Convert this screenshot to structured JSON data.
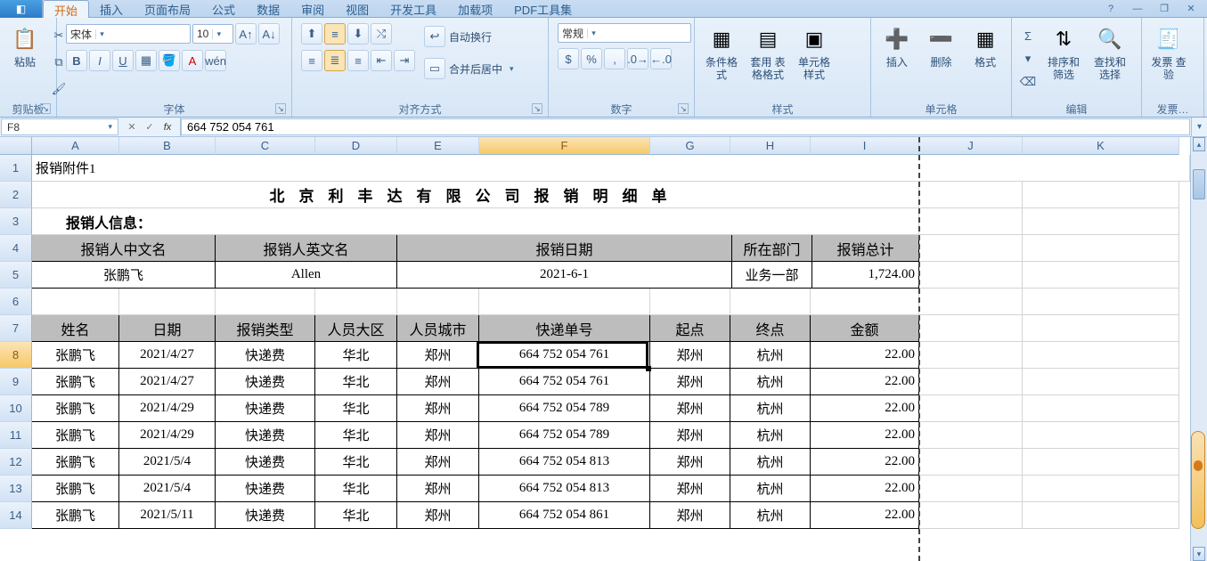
{
  "tabs": [
    "开始",
    "插入",
    "页面布局",
    "公式",
    "数据",
    "审阅",
    "视图",
    "开发工具",
    "加载项",
    "PDF工具集"
  ],
  "active_tab_index": 0,
  "help_icon": "?",
  "win_min": "—",
  "win_restore": "❐",
  "win_close": "✕",
  "clipboard": {
    "paste": "粘贴",
    "label": "剪贴板"
  },
  "font": {
    "name": "宋体",
    "size": "10",
    "label": "字体",
    "bold": "B",
    "italic": "I",
    "underline": "U"
  },
  "alignment": {
    "wrap_text": "自动换行",
    "merge": "合并后居中",
    "label": "对齐方式"
  },
  "number": {
    "format": "常规",
    "label": "数字"
  },
  "styles": {
    "cond": "条件格式",
    "table": "套用\n表格格式",
    "cell": "单元格\n样式",
    "label": "样式"
  },
  "cells": {
    "insert": "插入",
    "delete": "删除",
    "format": "格式",
    "label": "单元格"
  },
  "editing": {
    "sort": "排序和\n筛选",
    "find": "查找和\n选择",
    "label": "编辑"
  },
  "invoice": {
    "big": "发票\n查验",
    "label": "发票…"
  },
  "namebox": "F8",
  "formula": "664 752 054 761",
  "fx": "fx",
  "columns": [
    "A",
    "B",
    "C",
    "D",
    "E",
    "F",
    "G",
    "H",
    "I",
    "J",
    "K"
  ],
  "rows": [
    "1",
    "2",
    "3",
    "4",
    "5",
    "6",
    "7",
    "8",
    "9",
    "10",
    "11",
    "12",
    "13",
    "14"
  ],
  "active": {
    "col_index": 5,
    "row_index": 7
  },
  "content": {
    "r1a": "报销附件1",
    "r2_title": "北京利丰达有限公司报销明细单",
    "r3_label": "报销人信息：",
    "r4": {
      "cn": "报销人中文名",
      "en": "报销人英文名",
      "date": "报销日期",
      "dept": "所在部门",
      "total": "报销总计"
    },
    "r5": {
      "cn": "张鹏飞",
      "en": "Allen",
      "date": "2021-6-1",
      "dept": "业务一部",
      "total": "1,724.00"
    },
    "r7": {
      "name": "姓名",
      "date": "日期",
      "type": "报销类型",
      "region": "人员大区",
      "city": "人员城市",
      "track": "快递单号",
      "from": "起点",
      "to": "终点",
      "amt": "金额"
    },
    "data": [
      {
        "name": "张鹏飞",
        "date": "2021/4/27",
        "type": "快递费",
        "region": "华北",
        "city": "郑州",
        "track": "664 752 054 761",
        "from": "郑州",
        "to": "杭州",
        "amt": "22.00"
      },
      {
        "name": "张鹏飞",
        "date": "2021/4/27",
        "type": "快递费",
        "region": "华北",
        "city": "郑州",
        "track": "664 752 054 761",
        "from": "郑州",
        "to": "杭州",
        "amt": "22.00"
      },
      {
        "name": "张鹏飞",
        "date": "2021/4/29",
        "type": "快递费",
        "region": "华北",
        "city": "郑州",
        "track": "664 752 054 789",
        "from": "郑州",
        "to": "杭州",
        "amt": "22.00"
      },
      {
        "name": "张鹏飞",
        "date": "2021/4/29",
        "type": "快递费",
        "region": "华北",
        "city": "郑州",
        "track": "664 752 054 789",
        "from": "郑州",
        "to": "杭州",
        "amt": "22.00"
      },
      {
        "name": "张鹏飞",
        "date": "2021/5/4",
        "type": "快递费",
        "region": "华北",
        "city": "郑州",
        "track": "664 752 054 813",
        "from": "郑州",
        "to": "杭州",
        "amt": "22.00"
      },
      {
        "name": "张鹏飞",
        "date": "2021/5/4",
        "type": "快递费",
        "region": "华北",
        "city": "郑州",
        "track": "664 752 054 813",
        "from": "郑州",
        "to": "杭州",
        "amt": "22.00"
      },
      {
        "name": "张鹏飞",
        "date": "2021/5/11",
        "type": "快递费",
        "region": "华北",
        "city": "郑州",
        "track": "664 752 054 861",
        "from": "郑州",
        "to": "杭州",
        "amt": "22.00"
      }
    ]
  }
}
